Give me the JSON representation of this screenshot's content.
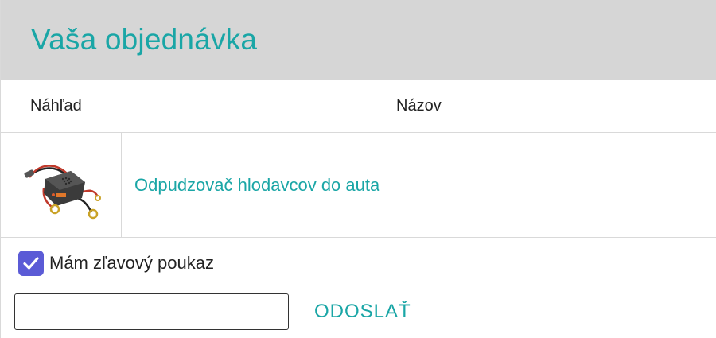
{
  "header": {
    "title": "Vaša objednávka"
  },
  "table": {
    "columns": {
      "preview": "Náhľad",
      "name": "Názov"
    },
    "rows": [
      {
        "name": "Odpudzovač hlodavcov do auta",
        "thumbnail": "car-rodent-repeller-device"
      }
    ]
  },
  "voucher": {
    "checked": true,
    "label": "Mám zľavový poukaz",
    "input_value": "",
    "input_placeholder": "",
    "submit_label": "ODOSLAŤ"
  },
  "colors": {
    "accent": "#1aa6a6",
    "header_bg": "#d6d6d6",
    "checkbox": "#5b5bd6"
  }
}
